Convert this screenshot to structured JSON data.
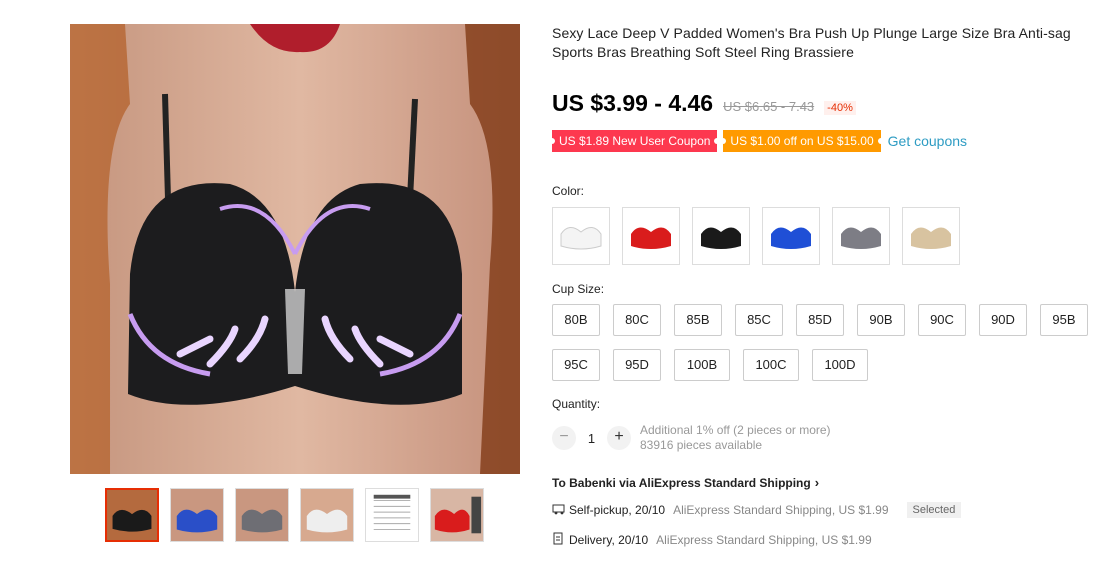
{
  "product": {
    "title": "Sexy Lace Deep V Padded Women's Bra Push Up Plunge Large Size Bra Anti-sag Sports Bras Breathing Soft Steel Ring Brassiere"
  },
  "price": {
    "current": "US $3.99 - 4.46",
    "original": "US $6.65 - 7.43",
    "discount": "-40%"
  },
  "coupons": {
    "new_user": "US $1.89 New User Coupon",
    "store": "US $1.00 off on US $15.00",
    "link": "Get coupons",
    "colors": {
      "new_user": "#fd384f",
      "store": "#ff9a00",
      "link": "#2e9cc3"
    }
  },
  "color": {
    "label": "Color:",
    "swatches": [
      {
        "name": "white",
        "hex": "#f4f4f4"
      },
      {
        "name": "red",
        "hex": "#d91c1c"
      },
      {
        "name": "black",
        "hex": "#1a1a1a"
      },
      {
        "name": "blue",
        "hex": "#1f4fd6"
      },
      {
        "name": "gray",
        "hex": "#7d7d85"
      },
      {
        "name": "nude",
        "hex": "#d8c3a0"
      }
    ]
  },
  "cup_size": {
    "label": "Cup Size:",
    "options": [
      "80B",
      "80C",
      "85B",
      "85C",
      "85D",
      "90B",
      "90C",
      "90D",
      "95B",
      "95C",
      "95D",
      "100B",
      "100C",
      "100D"
    ]
  },
  "quantity": {
    "label": "Quantity:",
    "value": "1",
    "minus": "−",
    "plus": "+",
    "note": "Additional 1% off (2 pieces or more)",
    "available": "83916 pieces available"
  },
  "shipping": {
    "title": "To Babenki via AliExpress Standard Shipping",
    "pickup": {
      "label": "Self-pickup, 20/10",
      "detail": "AliExpress Standard Shipping, US $1.99",
      "badge": "Selected"
    },
    "delivery": {
      "label": "Delivery, 20/10",
      "detail": "AliExpress Standard Shipping, US $1.99"
    }
  },
  "gallery": {
    "thumbnails": [
      {
        "name": "black",
        "hex": "#1a1a1a"
      },
      {
        "name": "blue",
        "hex": "#2a4fc8"
      },
      {
        "name": "gray",
        "hex": "#6e6e74"
      },
      {
        "name": "white",
        "hex": "#eeeeee"
      },
      {
        "name": "size-chart",
        "hex": "#ffffff"
      },
      {
        "name": "red",
        "hex": "#d91c1c"
      }
    ]
  }
}
